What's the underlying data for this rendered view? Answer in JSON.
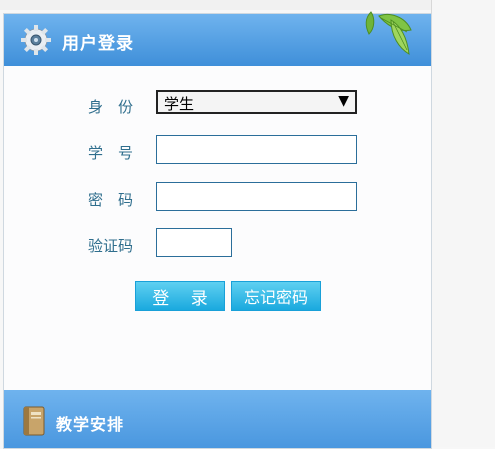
{
  "login_panel": {
    "title": "用户登录",
    "fields": {
      "identity": {
        "label": "身　份",
        "value": "学生",
        "arrow": "▼"
      },
      "student_id": {
        "label": "学　号",
        "value": ""
      },
      "password": {
        "label": "密　码",
        "value": ""
      },
      "captcha": {
        "label": "验证码",
        "value": ""
      }
    },
    "buttons": {
      "login": "登 录",
      "forgot_password": "忘记密码"
    }
  },
  "schedule_panel": {
    "title": "教学安排"
  },
  "colors": {
    "header_blue": "#4a97df",
    "button_cyan": "#1aa9de",
    "label_teal": "#2f6e8d"
  },
  "icons": {
    "login_header": "gear-icon",
    "decoration": "leaf-icon",
    "schedule_header": "book-icon"
  }
}
